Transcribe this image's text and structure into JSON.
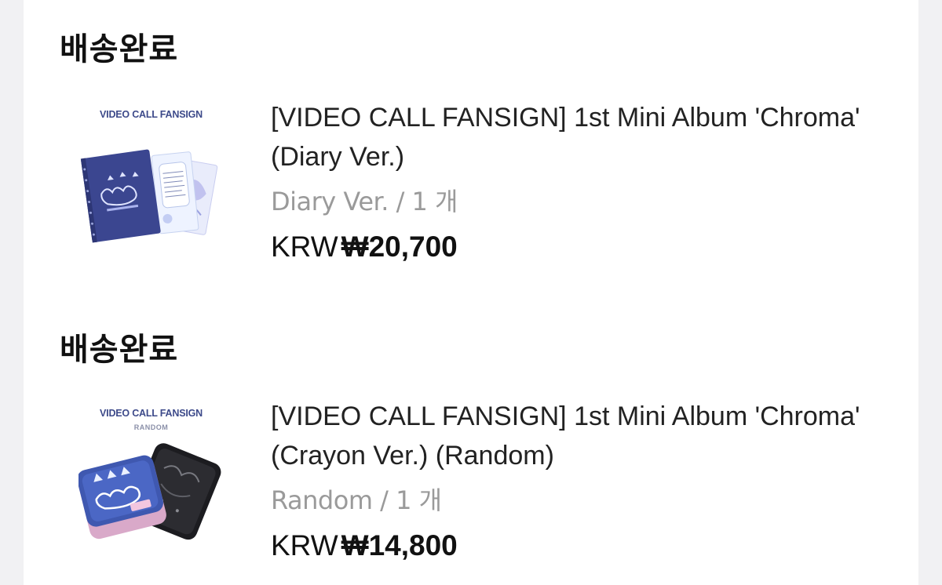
{
  "orders": [
    {
      "status": "배송완료",
      "thumb_caption": "VIDEO CALL FANSIGN",
      "thumb_sub": "",
      "title": "[VIDEO CALL FANSIGN] 1st Mini Album 'Chroma' (Diary Ver.)",
      "variant": "Diary Ver. / 1 개",
      "currency": "KRW",
      "amount": "₩20,700",
      "thumb_icon": "diary-album-image"
    },
    {
      "status": "배송완료",
      "thumb_caption": "VIDEO CALL FANSIGN",
      "thumb_sub": "RANDOM",
      "title": "[VIDEO CALL FANSIGN] 1st Mini Album 'Chroma' (Crayon Ver.) (Random)",
      "variant": "Random / 1 개",
      "currency": "KRW",
      "amount": "₩14,800",
      "thumb_icon": "crayon-tin-album-image"
    }
  ],
  "colors": {
    "page_bg": "#f1f1f3",
    "card_bg": "#ffffff",
    "text_primary": "#111111",
    "text_secondary": "#9a9a9a",
    "caption": "#3d4a8a"
  }
}
